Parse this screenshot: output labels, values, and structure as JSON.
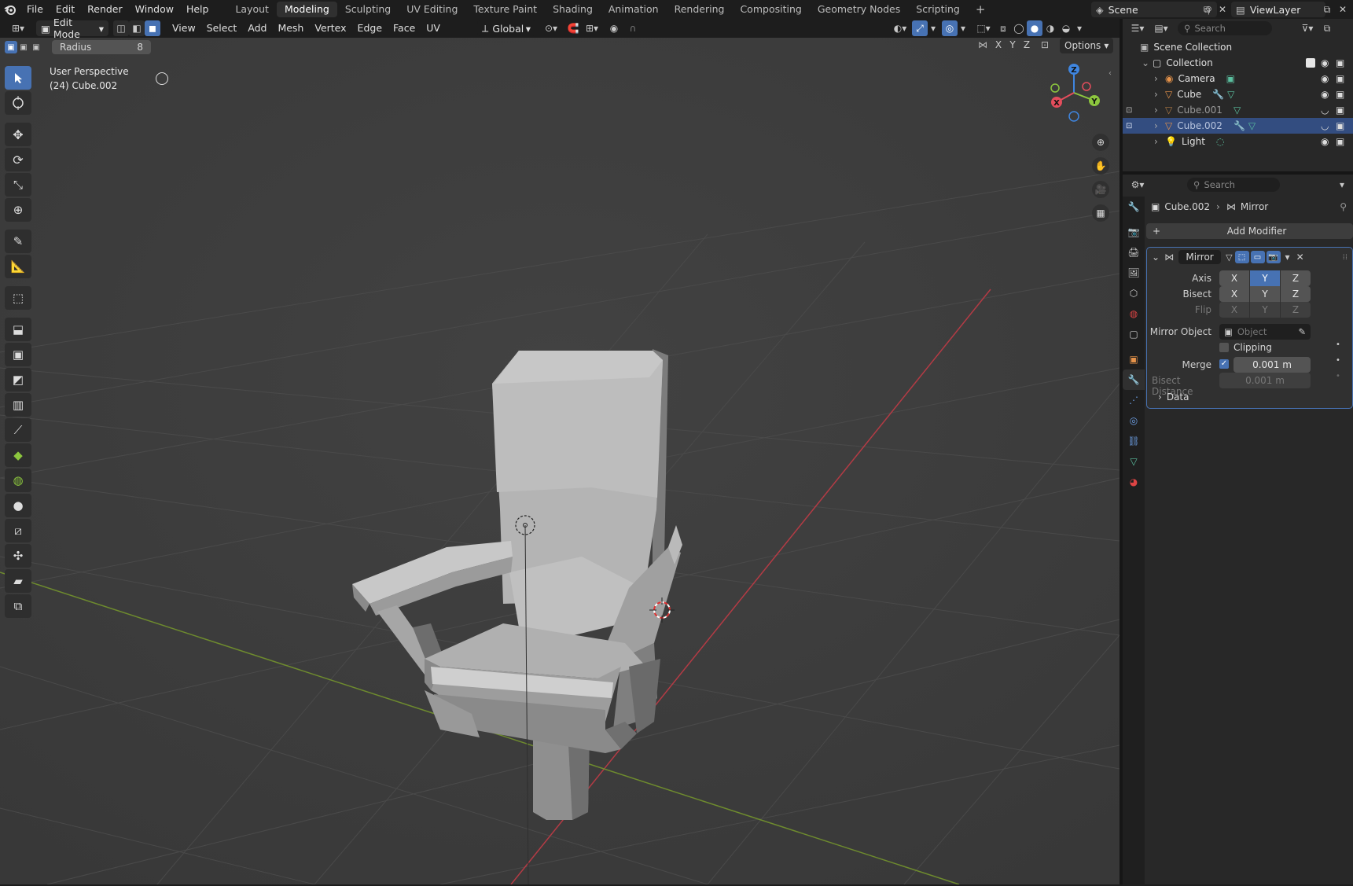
{
  "topbar": {
    "menus": [
      "File",
      "Edit",
      "Render",
      "Window",
      "Help"
    ],
    "workspaces": [
      "Layout",
      "Modeling",
      "Sculpting",
      "UV Editing",
      "Texture Paint",
      "Shading",
      "Animation",
      "Rendering",
      "Compositing",
      "Geometry Nodes",
      "Scripting"
    ],
    "active_workspace": "Modeling",
    "scene_name": "Scene",
    "view_layer": "ViewLayer"
  },
  "viewport_header": {
    "mode": "Edit Mode",
    "menus": [
      "View",
      "Select",
      "Add",
      "Mesh",
      "Vertex",
      "Edge",
      "Face",
      "UV"
    ],
    "orientation": "Global",
    "options_label": "Options",
    "axis_labels": [
      "X",
      "Y",
      "Z"
    ]
  },
  "redo_panel": {
    "label": "Radius",
    "value": "8"
  },
  "viewport": {
    "view_name": "User Perspective",
    "object_info": "(24) Cube.002",
    "gizmo_axes": {
      "x": "X",
      "y": "Y",
      "z": "Z"
    }
  },
  "outliner": {
    "search_placeholder": "Search",
    "scene_collection": "Scene Collection",
    "collection": "Collection",
    "items": [
      {
        "name": "Camera",
        "dim": false,
        "selected": false
      },
      {
        "name": "Cube",
        "dim": false,
        "selected": false
      },
      {
        "name": "Cube.001",
        "dim": true,
        "selected": false
      },
      {
        "name": "Cube.002",
        "dim": true,
        "selected": true
      },
      {
        "name": "Light",
        "dim": false,
        "selected": false
      }
    ]
  },
  "properties": {
    "search_placeholder": "Search",
    "breadcrumb_object": "Cube.002",
    "breadcrumb_modifier": "Mirror",
    "add_modifier_label": "Add Modifier",
    "modifier_name": "Mirror",
    "axis_label": "Axis",
    "bisect_label": "Bisect",
    "flip_label": "Flip",
    "axes": [
      "X",
      "Y",
      "Z"
    ],
    "axis_active": "Y",
    "mirror_object_label": "Mirror Object",
    "mirror_object_placeholder": "Object",
    "clipping_label": "Clipping",
    "merge_label": "Merge",
    "merge_value": "0.001 m",
    "bisect_distance_label": "Bisect Distance",
    "bisect_distance_value": "0.001 m",
    "data_label": "Data"
  },
  "colors": {
    "accent": "#4772b3",
    "x_axis": "#e44d5c",
    "y_axis": "#8cc63e",
    "z_axis": "#3f86e0",
    "grid_red": "#b43b45",
    "grid_green": "#6e8b2e"
  }
}
